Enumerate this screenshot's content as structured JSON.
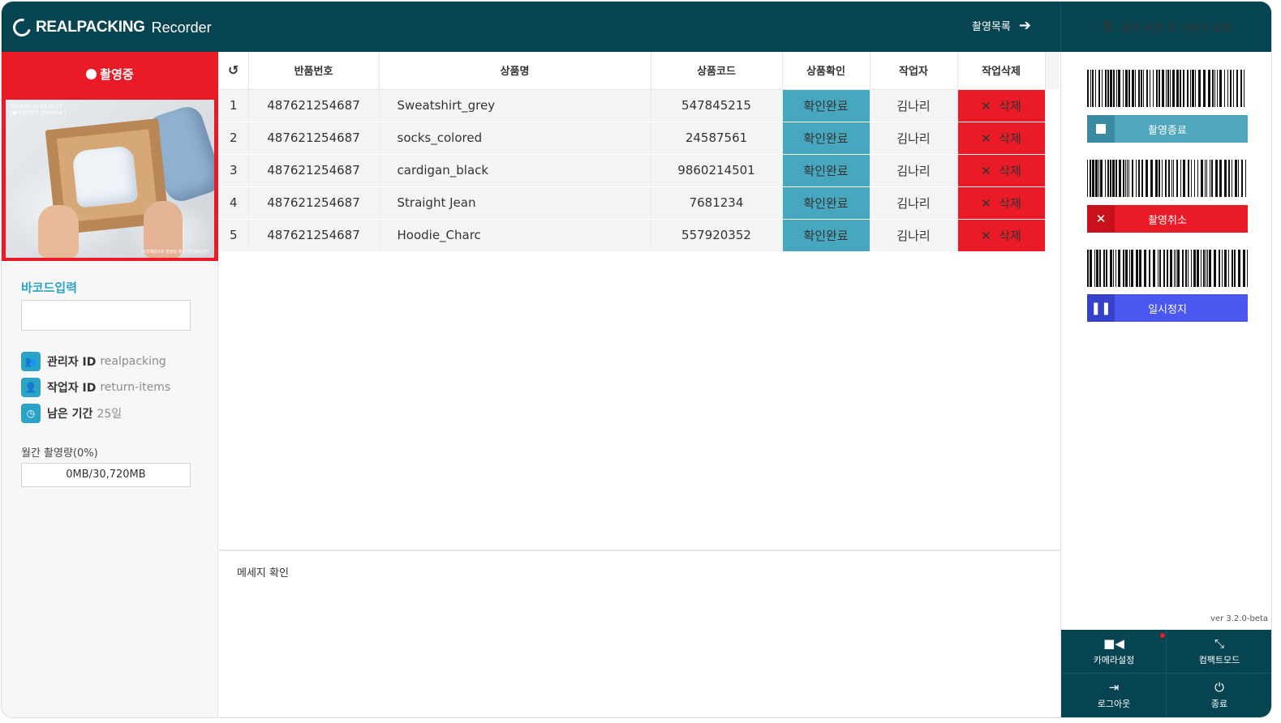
{
  "header": {
    "brand": "REALPACKING",
    "product": "Recorder",
    "recording_list": "촬영목록",
    "settings": "동작 버튼 및 사용자 설정"
  },
  "left": {
    "recording_status": "촬영중",
    "video_overlay_line1": "2025-06-19 09:14:57",
    "video_overlay_line2": "[●바코드번호 1546654 ]",
    "video_footer": "리얼패킹으로 촬영된 영상 무단배포금지",
    "barcode_title": "바코드입력",
    "barcode_input": {
      "value": "",
      "placeholder": ""
    },
    "info": [
      {
        "icon": "users-icon",
        "label": "관리자 ID",
        "value": "realpacking"
      },
      {
        "icon": "user-icon",
        "label": "작업자 ID",
        "value": "return-items"
      },
      {
        "icon": "clock-icon",
        "label": "남은 기간",
        "value": "25일"
      }
    ],
    "usage_label": "월간 촬영량(0%)",
    "usage_value": "0MB/30,720MB"
  },
  "table": {
    "columns": [
      "반품번호",
      "상품명",
      "상품코드",
      "상품확인",
      "작업자",
      "작업삭제"
    ],
    "rows": [
      {
        "no": "1",
        "return_no": "487621254687",
        "name": "Sweatshirt_grey",
        "code": "547845215",
        "check": "확인완료",
        "worker": "김나리",
        "delete": "삭제"
      },
      {
        "no": "2",
        "return_no": "487621254687",
        "name": "socks_colored",
        "code": "24587561",
        "check": "확인완료",
        "worker": "김나리",
        "delete": "삭제"
      },
      {
        "no": "3",
        "return_no": "487621254687",
        "name": "cardigan_black",
        "code": "9860214501",
        "check": "확인완료",
        "worker": "김나리",
        "delete": "삭제"
      },
      {
        "no": "4",
        "return_no": "487621254687",
        "name": "Straight Jean",
        "code": "7681234",
        "check": "확인완료",
        "worker": "김나리",
        "delete": "삭제"
      },
      {
        "no": "5",
        "return_no": "487621254687",
        "name": "Hoodie_Charc",
        "code": "557920352",
        "check": "확인완료",
        "worker": "김나리",
        "delete": "삭제"
      }
    ]
  },
  "message_title": "메세지 확인",
  "right": {
    "stop_label": "촬영종료",
    "cancel_label": "촬영취소",
    "pause_label": "일시정지",
    "version": "ver 3.2.0-beta",
    "bottom": {
      "camera": "카메라설정",
      "compact": "컴팩트모드",
      "logout": "로그아웃",
      "exit": "종료"
    }
  },
  "colors": {
    "header": "#054450",
    "red": "#ea1a26",
    "teal": "#47a7be",
    "stop_btn": "#4ea6bf",
    "pause_btn": "#4a57f0"
  }
}
